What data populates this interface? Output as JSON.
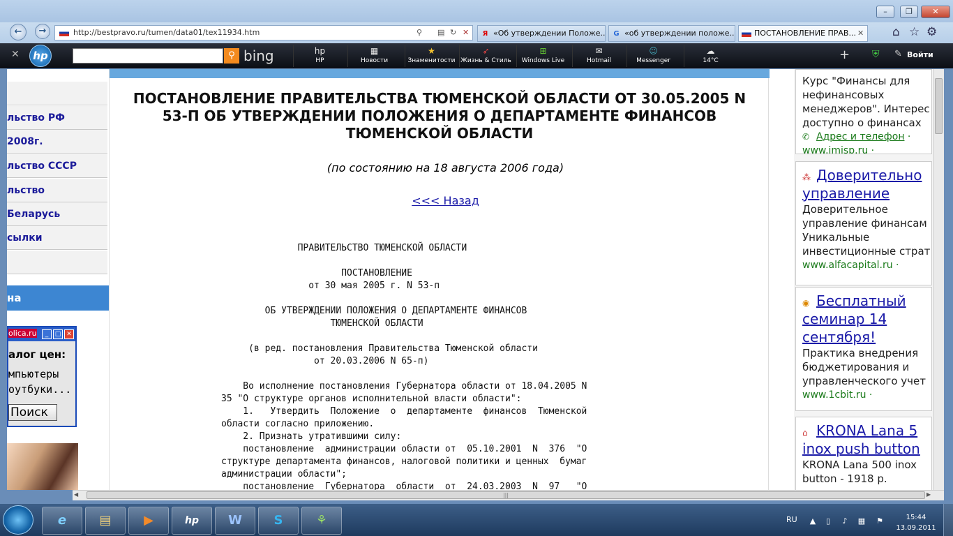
{
  "browser": {
    "url": "http://bestpravo.ru/tumen/data01/tex11934.htm",
    "tabs": [
      {
        "icon": "Я",
        "title": "«Об утверждении Положе..."
      },
      {
        "icon": "G",
        "title": "«об утверждении положе..."
      },
      {
        "icon": "ru",
        "title": "ПОСТАНОВЛЕНИЕ ПРАВ..."
      }
    ],
    "win_buttons": [
      "–",
      "❐",
      "✕"
    ]
  },
  "toolbar": {
    "bing_label": "bing",
    "items": [
      {
        "icon": "hp",
        "label": "HP"
      },
      {
        "icon": "▦",
        "label": "Новости"
      },
      {
        "icon": "★",
        "label": "Знаменитости"
      },
      {
        "icon": "➶",
        "label": "Жизнь & Стиль"
      },
      {
        "icon": "⊞",
        "label": "Windows Live"
      },
      {
        "icon": "✉",
        "label": "Hotmail"
      },
      {
        "icon": "☺",
        "label": "Messenger"
      },
      {
        "icon": "☁",
        "label": "14°C"
      }
    ],
    "login": "Войти"
  },
  "left": {
    "menu": [
      "",
      "льство РФ",
      " 2008г.",
      "льство СССР",
      "льство",
      " Беларусь",
      "сылки",
      ""
    ],
    "section_title": "на",
    "ad": {
      "site": "olica.ru",
      "line1": "алог цен:",
      "line2": "мпьютеры\nоутбуки...",
      "button": "Поиск"
    }
  },
  "doc": {
    "title": "ПОСТАНОВЛЕНИЕ ПРАВИТЕЛЬСТВА ТЮМЕНСКОЙ ОБЛАСТИ ОТ 30.05.2005 N 53-П ОБ УТВЕРЖДЕНИИ ПОЛОЖЕНИЯ О ДЕПАРТАМЕНТЕ ФИНАНСОВ ТЮМЕНСКОЙ ОБЛАСТИ",
    "status": "(по состоянию на 18 августа 2006 года)",
    "back": "<<< Назад",
    "body": "              ПРАВИТЕЛЬСТВО ТЮМЕНСКОЙ ОБЛАСТИ\n\n                      ПОСТАНОВЛЕНИЕ\n                от 30 мая 2005 г. N 53-п\n\n        ОБ УТВЕРЖДЕНИИ ПОЛОЖЕНИЯ О ДЕПАРТАМЕНТЕ ФИНАНСОВ\n                    ТЮМЕНСКОЙ ОБЛАСТИ\n\n     (в ред. постановления Правительства Тюменской области\n                 от 20.03.2006 N 65-п)\n\n    Во исполнение постановления Губернатора области от 18.04.2005 N\n35 \"О структуре органов исполнительной власти области\":\n    1.   Утвердить  Положение  о  департаменте  финансов  Тюменской\nобласти согласно приложению.\n    2. Признать утратившими силу:\n    постановление  администрации области от  05.10.2001  N  376  \"О\nструктуре департамента финансов, налоговой политики и ценных  бумаг\nадминистрации области\";\n    постановление  Губернатора  области  от  24.03.2003  N  97   \"О"
  },
  "right": {
    "ads": [
      {
        "desc": "Курс \"Финансы для\nнефинансовых\nменеджеров\". Интерес\nдоступно о финансах",
        "link": "Адрес и телефон",
        "url": "www.imisp.ru"
      },
      {
        "title": "Доверительно\nуправление",
        "desc": "Доверительное\nуправление финансам\nУникальные\nинвестиционные страт",
        "url": "www.alfacapital.ru"
      },
      {
        "title": "Бесплатный\nсеминар 14\nсентября!",
        "desc": "Практика внедрения\nбюджетирования и\nуправленческого учет",
        "url": "www.1cbit.ru"
      },
      {
        "title": "KRONA Lana 5\ninox push button",
        "desc": "KRONA Lana 500 inox\nbutton - 1918 р."
      }
    ]
  },
  "taskbar": {
    "apps": [
      "e",
      "▤",
      "▶",
      "hp",
      "W",
      "S",
      "⚘"
    ],
    "lang": "RU",
    "time": "15:44",
    "date": "13.09.2011"
  }
}
